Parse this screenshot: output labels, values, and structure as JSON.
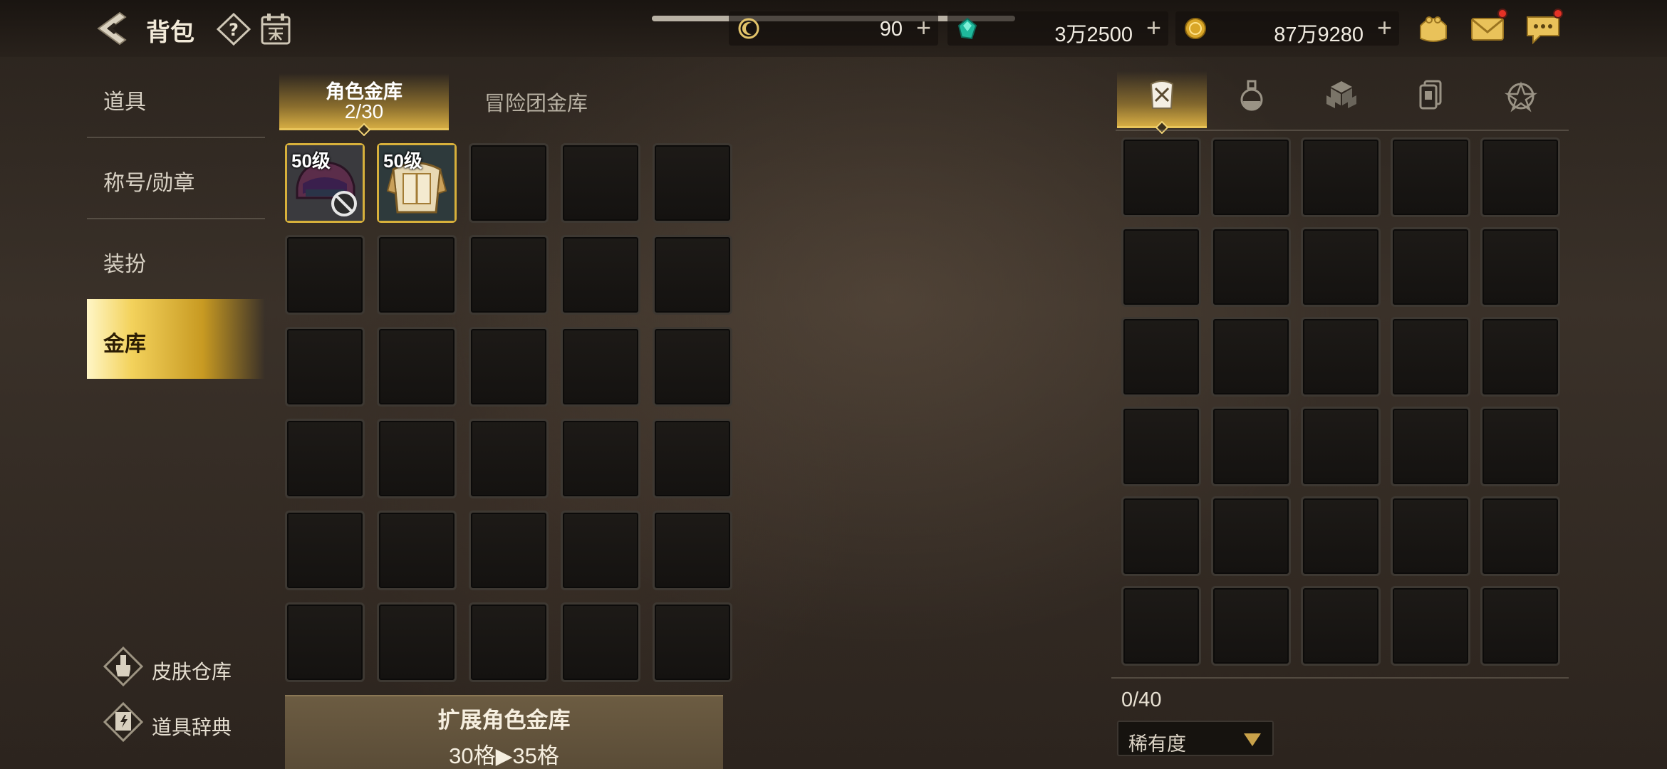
{
  "header": {
    "title": "背包",
    "currencies": [
      {
        "icon": "crescent-coin-icon",
        "value": "90"
      },
      {
        "icon": "green-gem-icon",
        "value": "3万2500"
      },
      {
        "icon": "gold-coin-icon",
        "value": "87万9280"
      }
    ],
    "icons": [
      "purse-icon",
      "mail-icon",
      "chat-icon"
    ]
  },
  "sidebar": {
    "items": [
      {
        "label": "道具"
      },
      {
        "label": "称号/勋章"
      },
      {
        "label": "装扮"
      },
      {
        "label": "金库",
        "active": true
      }
    ],
    "links": [
      {
        "label": "皮肤仓库",
        "icon": "brush-icon"
      },
      {
        "label": "道具辞典",
        "icon": "book-icon"
      }
    ]
  },
  "storage": {
    "tab_character_label": "角色金库",
    "tab_character_count": "2/30",
    "tab_team_label": "冒险团金库",
    "items": [
      {
        "level": "50级",
        "icon": "helmet-forbidden-icon"
      },
      {
        "level": "50级",
        "icon": "armor-icon"
      }
    ],
    "expand_label": "扩展角色金库",
    "expand_detail": "30格▶35格"
  },
  "inventory": {
    "category_icons": [
      "armor-category-icon",
      "potion-category-icon",
      "material-category-icon",
      "card-category-icon",
      "emblem-category-icon"
    ],
    "count": "0/40",
    "sort_label": "稀有度"
  },
  "colors": {
    "accent_gold": "#e8c45a",
    "active_tab_gradient_start": "#fff6c6",
    "badge_red": "#e53226"
  }
}
